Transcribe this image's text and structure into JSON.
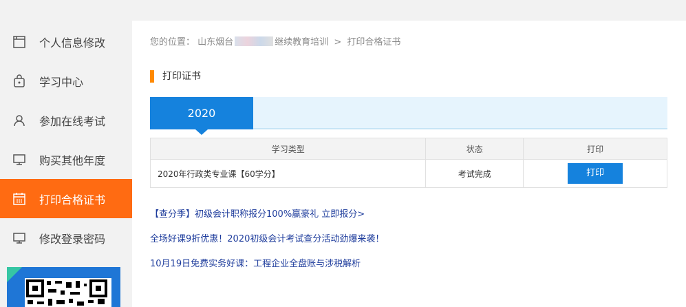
{
  "sidebar": {
    "items": [
      {
        "label": "个人信息修改",
        "icon": "profile-card-icon",
        "active": false
      },
      {
        "label": "学习中心",
        "icon": "lock-bag-icon",
        "active": false
      },
      {
        "label": "参加在线考试",
        "icon": "user-icon",
        "active": false
      },
      {
        "label": "购买其他年度",
        "icon": "monitor-icon",
        "active": false
      },
      {
        "label": "打印合格证书",
        "icon": "calendar-icon",
        "active": true
      },
      {
        "label": "修改登录密码",
        "icon": "monitor-icon",
        "active": false
      }
    ]
  },
  "breadcrumb": {
    "prefix": "您的位置：",
    "location": "山东烟台",
    "section": "继续教育培训",
    "separator": ">",
    "current": "打印合格证书"
  },
  "section_title": "打印证书",
  "year_tab": "2020",
  "table": {
    "headers": [
      "学习类型",
      "状态",
      "打印"
    ],
    "rows": [
      {
        "type": "2020年行政类专业课【60学分】",
        "status": "考试完成",
        "action": "打印"
      }
    ]
  },
  "promos": [
    "【查分季】初级会计职称报分100%赢豪礼 立即报分>",
    "全场好课9折优惠！2020初级会计考试查分活动劲爆来袭！",
    "10月19日免费实务好课：工程企业全盘账与涉税解析"
  ],
  "colors": {
    "accent": "#ff6b12",
    "primary": "#1582dd",
    "link": "#1e3c9c"
  }
}
